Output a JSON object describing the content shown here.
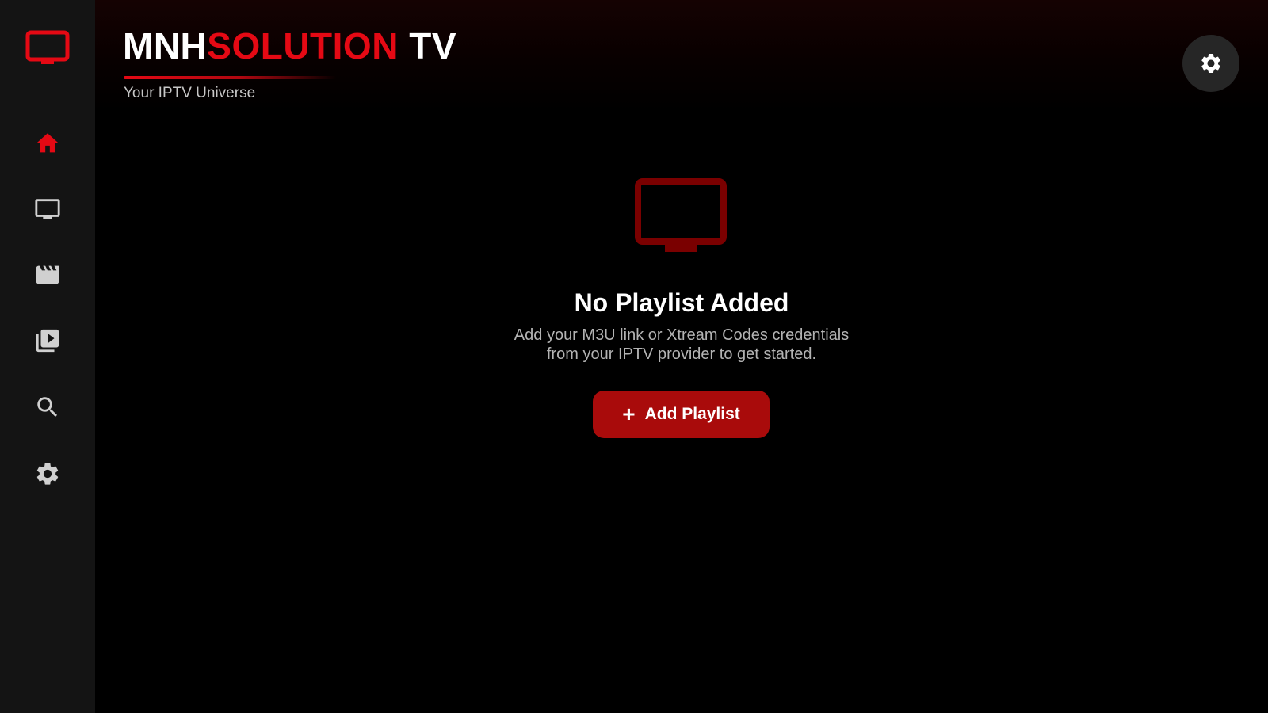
{
  "app": {
    "brand_part1": "MNH",
    "brand_part2": "SOLUTION",
    "brand_part3": " TV",
    "tagline": "Your IPTV Universe"
  },
  "colors": {
    "accent": "#e50914",
    "button": "#a90b0b",
    "sidebar_bg": "#141414",
    "background": "#000000"
  },
  "sidebar": {
    "logo_icon": "tv-icon",
    "items": [
      {
        "icon": "home-icon",
        "active": true
      },
      {
        "icon": "live-tv-icon",
        "active": false
      },
      {
        "icon": "movie-icon",
        "active": false
      },
      {
        "icon": "series-library-icon",
        "active": false
      },
      {
        "icon": "search-icon",
        "active": false
      },
      {
        "icon": "settings-icon",
        "active": false
      }
    ]
  },
  "header": {
    "settings_icon": "settings-icon"
  },
  "empty_state": {
    "icon": "tv-icon",
    "title": "No Playlist Added",
    "description_line1": "Add your M3U link or Xtream Codes credentials",
    "description_line2": "from your IPTV provider to get started.",
    "button_icon": "plus-icon",
    "button_plus": "+",
    "button_label": "Add Playlist"
  }
}
